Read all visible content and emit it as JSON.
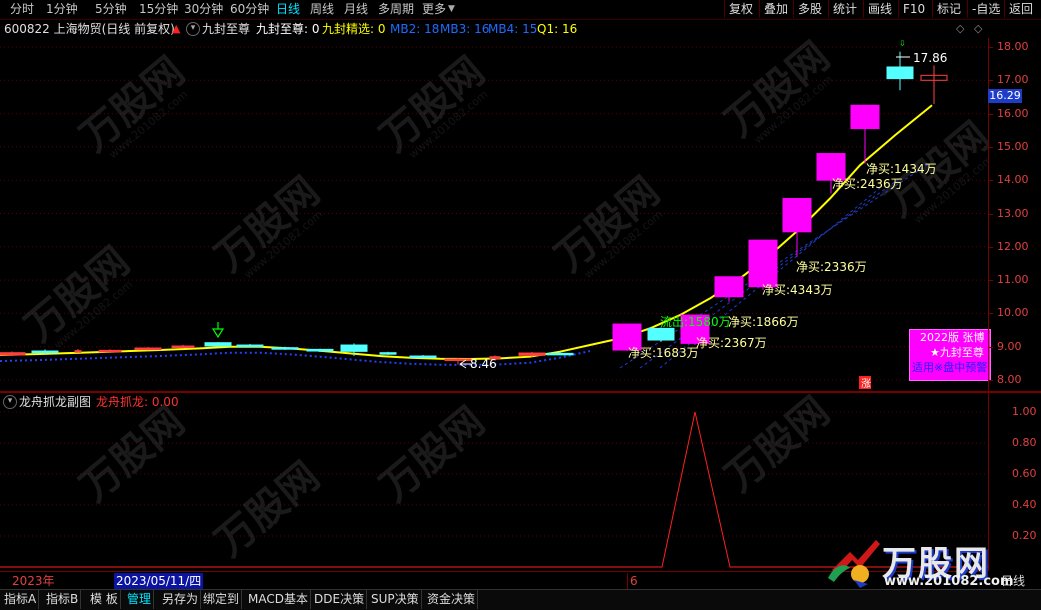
{
  "toolbar": {
    "periods": [
      "分时",
      "1分钟",
      "5分钟",
      "15分钟",
      "30分钟",
      "60分钟",
      "日线",
      "周线",
      "月线",
      "多周期",
      "更多"
    ],
    "active_period": "日线",
    "buttons": [
      "复权",
      "叠加",
      "多股",
      "统计",
      "画线",
      "F10",
      "标记",
      "-自选",
      "返回"
    ]
  },
  "info_line": {
    "stock": "600822 上海物贸(日线 前复权)",
    "indicator": "九封至尊",
    "values": [
      {
        "text": "九封至尊: 0",
        "color": "#ffffff"
      },
      {
        "text": "九封精选: 0",
        "color": "#ffff00"
      },
      {
        "text": "MB2: 18",
        "color": "#1e6bff"
      },
      {
        "text": "MB3: 16",
        "color": "#1e6bff"
      },
      {
        "text": "MB4: 15",
        "color": "#1e6bff"
      },
      {
        "text": "Q1: 16",
        "color": "#ffff00"
      }
    ]
  },
  "price_axis": {
    "labels": [
      "18.00",
      "17.00",
      "16.00",
      "15.00",
      "14.00",
      "13.00",
      "12.00",
      "11.00",
      "10.00",
      "9.00",
      "8.00"
    ],
    "current_price": "16.29"
  },
  "chart_data": [
    {
      "type": "candlestick",
      "title": "600822 上海物贸(日线 前复权)",
      "ylim": [
        7.7,
        18.2
      ],
      "candles": [
        {
          "o": 8.75,
          "c": 8.82,
          "h": 8.86,
          "l": 8.72,
          "color": "#ff4040"
        },
        {
          "o": 8.87,
          "c": 8.82,
          "h": 8.92,
          "l": 8.78,
          "color": "#54ffff"
        },
        {
          "o": 8.85,
          "c": 8.88,
          "h": 8.93,
          "l": 8.83,
          "color": "#ff4040"
        },
        {
          "o": 8.86,
          "c": 8.89,
          "h": 8.92,
          "l": 8.84,
          "color": "#ff4040"
        },
        {
          "o": 8.92,
          "c": 8.96,
          "h": 8.99,
          "l": 8.89,
          "color": "#ff4040"
        },
        {
          "o": 8.98,
          "c": 9.02,
          "h": 9.06,
          "l": 8.95,
          "color": "#ff4040"
        },
        {
          "o": 9.12,
          "c": 9.02,
          "h": 9.14,
          "l": 9.0,
          "color": "#54ffff"
        },
        {
          "o": 9.05,
          "c": 9.0,
          "h": 9.08,
          "l": 8.98,
          "color": "#54ffff"
        },
        {
          "o": 8.97,
          "c": 8.93,
          "h": 9.0,
          "l": 8.9,
          "color": "#54ffff"
        },
        {
          "o": 8.92,
          "c": 8.87,
          "h": 8.94,
          "l": 8.84,
          "color": "#54ffff"
        },
        {
          "o": 9.05,
          "c": 8.86,
          "h": 9.1,
          "l": 8.72,
          "color": "#54ffff"
        },
        {
          "o": 8.82,
          "c": 8.78,
          "h": 8.85,
          "l": 8.75,
          "color": "#54ffff"
        },
        {
          "o": 8.72,
          "c": 8.69,
          "h": 8.75,
          "l": 8.67,
          "color": "#54ffff"
        },
        {
          "o": 8.62,
          "c": 8.63,
          "h": 8.66,
          "l": 8.46,
          "color": "#ff4040"
        },
        {
          "o": 8.64,
          "c": 8.7,
          "h": 8.74,
          "l": 8.6,
          "color": "#ff4040"
        },
        {
          "o": 8.74,
          "c": 8.81,
          "h": 8.84,
          "l": 8.7,
          "color": "#ff4040"
        },
        {
          "o": 8.8,
          "c": 8.78,
          "h": 8.84,
          "l": 8.76,
          "color": "#54ffff"
        },
        {
          "o": 8.9,
          "c": 9.68,
          "h": 9.68,
          "l": 8.88,
          "color": "#ff00ff"
        },
        {
          "o": 9.55,
          "c": 9.2,
          "h": 9.58,
          "l": 9.15,
          "color": "#54ffff"
        },
        {
          "o": 9.1,
          "c": 9.95,
          "h": 9.95,
          "l": 9.05,
          "color": "#ff00ff"
        },
        {
          "o": 10.5,
          "c": 11.1,
          "h": 11.1,
          "l": 10.35,
          "color": "#ff00ff"
        },
        {
          "o": 10.8,
          "c": 12.2,
          "h": 12.2,
          "l": 10.7,
          "color": "#ff00ff"
        },
        {
          "o": 12.45,
          "c": 13.45,
          "h": 13.45,
          "l": 11.7,
          "color": "#ff00ff"
        },
        {
          "o": 14.0,
          "c": 14.8,
          "h": 14.8,
          "l": 13.6,
          "color": "#ff00ff"
        },
        {
          "o": 15.55,
          "c": 16.25,
          "h": 16.25,
          "l": 14.5,
          "color": "#ff00ff"
        },
        {
          "o": 17.05,
          "c": 17.4,
          "h": 17.86,
          "l": 16.7,
          "color": "#54ffff"
        },
        {
          "o": 17.15,
          "c": 17.0,
          "h": 17.45,
          "l": 16.29,
          "color": "#ff4040"
        }
      ],
      "ma_line": [
        8.75,
        8.78,
        8.82,
        8.86,
        8.9,
        8.95,
        9.0,
        9.0,
        8.95,
        8.88,
        8.8,
        8.72,
        8.67,
        8.64,
        8.63,
        8.65,
        8.7,
        8.85,
        9.05,
        9.25,
        9.55,
        9.95,
        10.45,
        11.05,
        11.75,
        12.55,
        13.45,
        14.45,
        15.35,
        16.25
      ],
      "annotations": [
        {
          "text": "净买:1434万",
          "color": "#ffff9c"
        },
        {
          "text": "净买:2436万",
          "color": "#ffff9c"
        },
        {
          "text": "净买:2336万",
          "color": "#ffff9c"
        },
        {
          "text": "净买:4343万",
          "color": "#ffff9c"
        },
        {
          "text": "流出:1580万",
          "color": "#00ff00"
        },
        {
          "text": "净买:1866万",
          "color": "#ffff9c"
        },
        {
          "text": "净买:2367万",
          "color": "#ffff9c"
        },
        {
          "text": "净买:1683万",
          "color": "#ffff9c"
        },
        {
          "text": "17.86",
          "color": "#ffffff"
        },
        {
          "text": "8.46",
          "color": "#ffffff"
        },
        {
          "text": "涨",
          "color": "#ffffff"
        }
      ]
    },
    {
      "type": "line",
      "title": "龙舟抓龙副图",
      "ylim": [
        0,
        1.1
      ],
      "y_ticks": [
        "1.00",
        "0.80",
        "0.60",
        "0.40",
        "0.20"
      ],
      "x": [
        0,
        1,
        2,
        3,
        4,
        5,
        6,
        7,
        8,
        9,
        10,
        11,
        12,
        13,
        14,
        15,
        16,
        17,
        18,
        19,
        20,
        21,
        22,
        23,
        24,
        25,
        26,
        27
      ],
      "series": [
        {
          "color": "#ff2020",
          "values": [
            0,
            0,
            0,
            0,
            0,
            0,
            0,
            0,
            0,
            0,
            0,
            0,
            0,
            0,
            0,
            0,
            0,
            0,
            0,
            0,
            0,
            1,
            0,
            0,
            0,
            0,
            0,
            0
          ]
        }
      ]
    }
  ],
  "promo": {
    "line1": "2022版 张博",
    "line2": "★九封至尊",
    "line3": "适用※盘中预警"
  },
  "sub_panel": {
    "title": "龙舟抓龙副图",
    "value_label": "龙舟抓龙: 0.00"
  },
  "date_bar": {
    "year": "2023年",
    "cursor_date": "2023/05/11/四",
    "month_marker": "6",
    "right_label": "日线"
  },
  "bottom_tabs": [
    "指标A",
    "指标B",
    "模 板",
    "管理",
    "另存为",
    "绑定到",
    "MACD基本",
    "DDE决策",
    "SUP决策",
    "资金决策"
  ],
  "watermark": {
    "brand": "万股网",
    "url": "www.201082.com"
  },
  "colors": {
    "bg": "#000000",
    "grid": "#5a0000",
    "axis_text": "#e04040",
    "up_box": "#ff00ff",
    "cyan": "#54ffff",
    "ma": "#ffff00"
  }
}
